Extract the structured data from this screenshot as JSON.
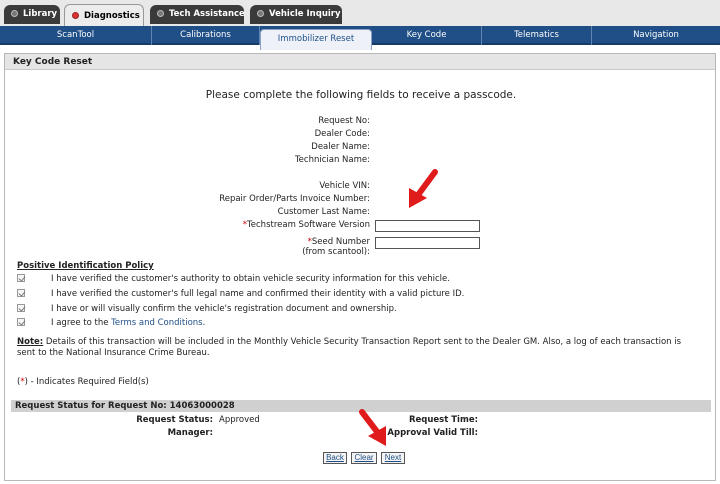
{
  "top_tabs": [
    {
      "label": "Library",
      "active": false
    },
    {
      "label": "Diagnostics",
      "active": true
    },
    {
      "label": "Tech Assistance",
      "active": false
    },
    {
      "label": "Vehicle Inquiry",
      "active": false
    }
  ],
  "sub_nav": [
    {
      "label": "ScanTool",
      "active": false
    },
    {
      "label": "Calibrations",
      "active": false
    },
    {
      "label": "Immobilizer Reset",
      "active": true
    },
    {
      "label": "Key Code",
      "active": false
    },
    {
      "label": "Telematics",
      "active": false
    },
    {
      "label": "Navigation",
      "active": false
    }
  ],
  "section": {
    "title": "Key Code Reset"
  },
  "intro": "Please complete the following fields to receive a passcode.",
  "fields": {
    "request_no": "Request No:",
    "dealer_code": "Dealer Code:",
    "dealer_name": "Dealer Name:",
    "technician_name": "Technician Name:",
    "vehicle_vin": "Vehicle VIN:",
    "repair_order": "Repair Order/Parts Invoice Number:",
    "customer_last_name": "Customer Last Name:",
    "techstream_required": "*",
    "techstream_label": "Techstream Software Version",
    "seed_required": "*",
    "seed_label": "Seed Number",
    "seed_sublabel": "(from scantool):",
    "techstream_value": "",
    "seed_value": ""
  },
  "policy": {
    "title": "Positive Identification Policy",
    "items": [
      "I have verified the customer's authority to obtain vehicle security information for this vehicle.",
      "I have verified the customer's full legal name and confirmed their identity with a valid picture ID.",
      "I have or will visually confirm the vehicle's registration document and ownership."
    ],
    "terms_prefix": "I agree to the ",
    "terms_link": "Terms and Conditions",
    "terms_suffix": "."
  },
  "note": {
    "label": "Note:",
    "text": " Details of this transaction will be included in the Monthly Vehicle Security Transaction Report sent to the Dealer GM. Also, a log of each transaction is sent to the National Insurance Crime Bureau."
  },
  "required_note": {
    "open": "(",
    "star": "*",
    "close": ") - Indicates Required Field(s)"
  },
  "status": {
    "header": "Request Status for Request No: 14063000028",
    "request_status_label": "Request Status:",
    "request_status_value": "Approved",
    "manager_label": "Manager:",
    "request_time_label": "Request Time:",
    "approval_valid_label": "Approval Valid Till:"
  },
  "buttons": {
    "back": "Back",
    "clear": "Clear",
    "next": "Next"
  },
  "colors": {
    "nav_blue": "#1f4f86",
    "required_red": "#cc0000",
    "arrow_red": "#e01b1b"
  }
}
